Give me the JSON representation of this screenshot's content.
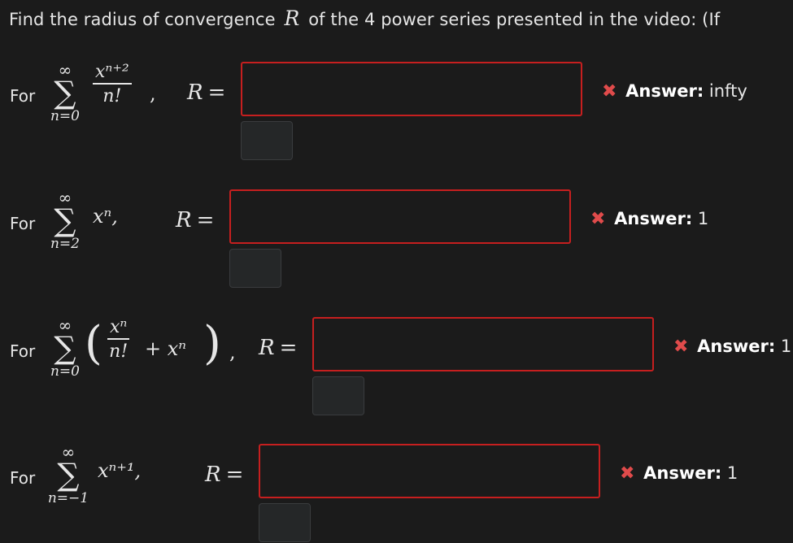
{
  "question": {
    "text_before": "Find the radius of convergence",
    "var": "R",
    "text_after": "of the 4 power series presented in the video: (If"
  },
  "rows": [
    {
      "for_label": "For",
      "sum_upper": "∞",
      "sum_lower": "n=0",
      "term_numerator": "xⁿ⁺²",
      "term_denominator": "n!",
      "term_suffix": ",",
      "r_label": "R",
      "eq_sign": "=",
      "input_value": "",
      "feedback_icon": "✖",
      "feedback_label": "Answer:",
      "feedback_value": "infty"
    },
    {
      "for_label": "For",
      "sum_upper": "∞",
      "sum_lower": "n=2",
      "term": "xⁿ,",
      "r_label": "R",
      "eq_sign": "=",
      "input_value": "",
      "feedback_icon": "✖",
      "feedback_label": "Answer:",
      "feedback_value": "1"
    },
    {
      "for_label": "For",
      "sum_upper": "∞",
      "sum_lower": "n=0",
      "paren_open": "(",
      "term_numerator": "xⁿ",
      "term_denominator": "n!",
      "term_plus": "+ xⁿ",
      "paren_close": ")",
      "term_suffix": ",",
      "r_label": "R",
      "eq_sign": "=",
      "input_value": "",
      "feedback_icon": "✖",
      "feedback_label": "Answer:",
      "feedback_value": "1"
    },
    {
      "for_label": "For",
      "sum_upper": "∞",
      "sum_lower": "n=−1",
      "term": "xⁿ⁺¹,",
      "r_label": "R",
      "eq_sign": "=",
      "input_value": "",
      "feedback_icon": "✖",
      "feedback_label": "Answer:",
      "feedback_value": "1"
    }
  ],
  "colors": {
    "background": "#1b1b1b",
    "input_border_error": "#c61f1f",
    "error_icon": "#e04b4b"
  },
  "icons": {
    "feedback": "x-icon",
    "sum": "sigma-icon"
  }
}
